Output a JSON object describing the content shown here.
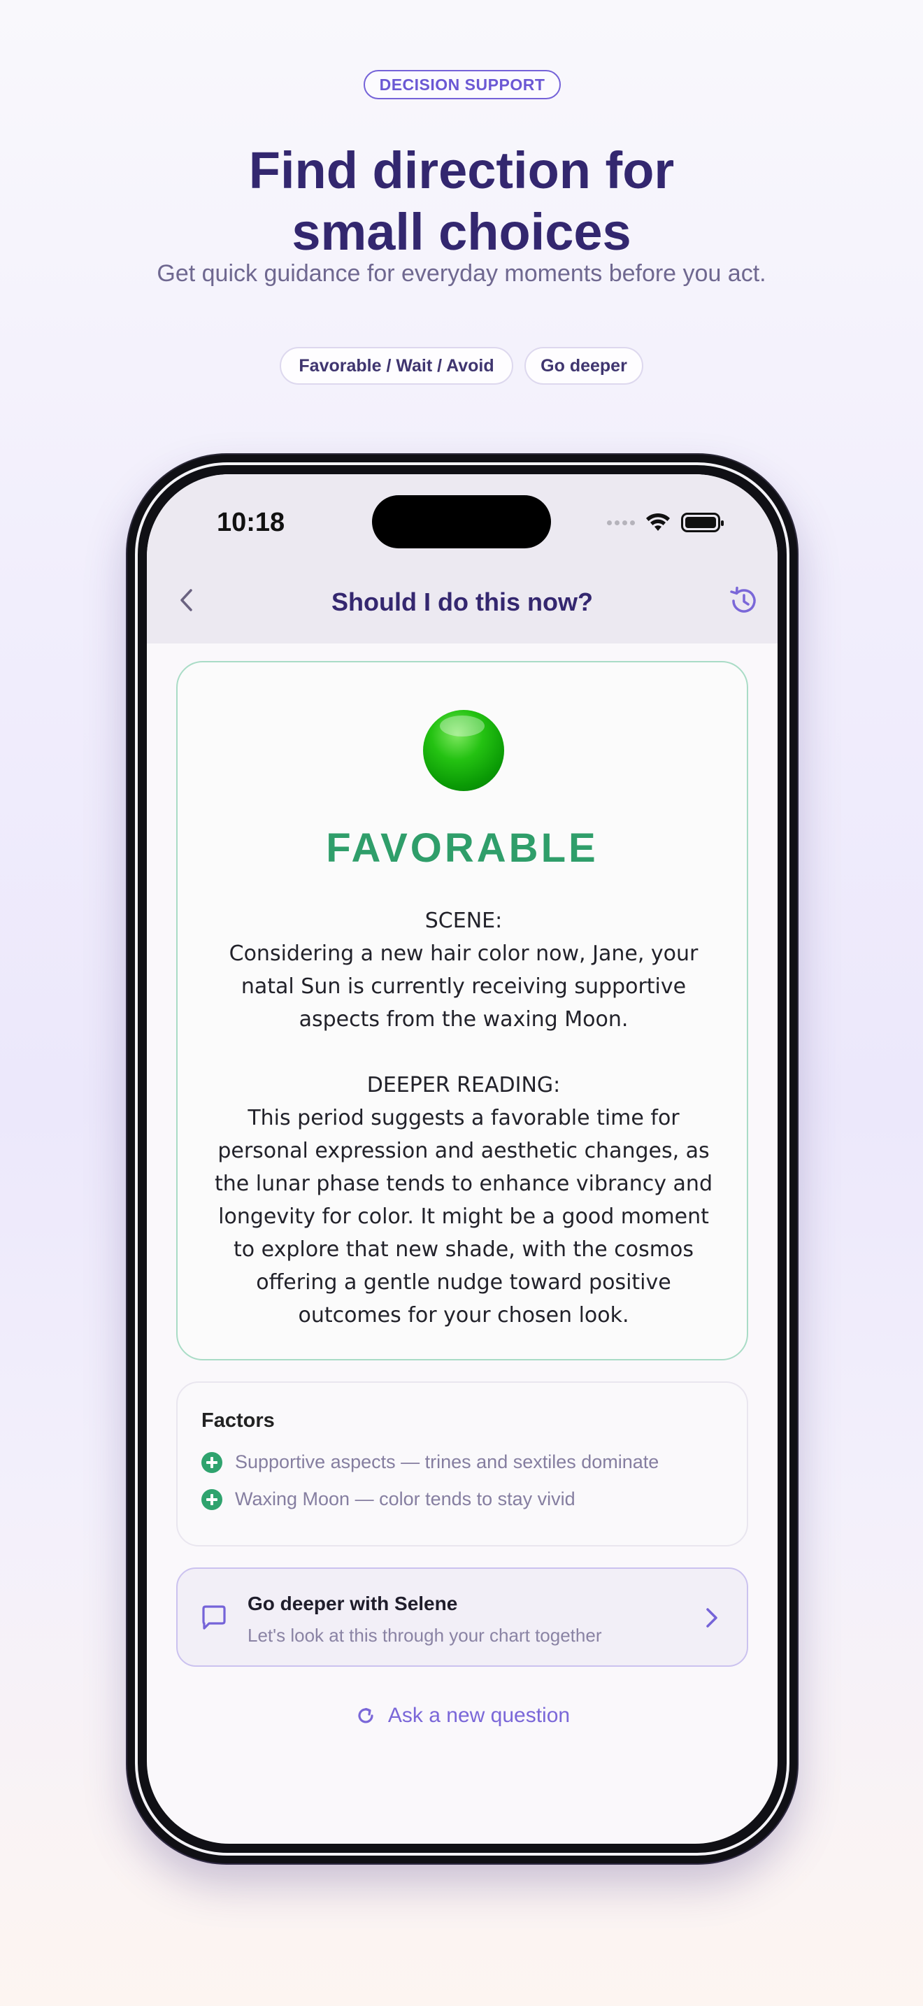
{
  "header": {
    "badge": "DECISION SUPPORT",
    "headline_line1": "Find direction for",
    "headline_line2": "small choices",
    "subheadline": "Get quick guidance for everyday moments before you act.",
    "pills": [
      "Favorable / Wait / Avoid",
      "Go deeper"
    ]
  },
  "status_bar": {
    "time": "10:18",
    "icons": [
      "signal-icon",
      "wifi-icon",
      "battery-icon"
    ]
  },
  "nav": {
    "title": "Should I do this now?",
    "back_icon": "chevron-left-icon",
    "history_icon": "history-icon"
  },
  "result": {
    "indicator_icon": "green-circle-icon",
    "verdict": "FAVORABLE",
    "scene_label": "SCENE:",
    "scene_text": "Considering a new hair color now, Jane, your natal Sun is currently receiving supportive aspects from the waxing Moon.",
    "deeper_label": "DEEPER READING:",
    "deeper_text": "This period suggests a favorable time for personal expression and aesthetic changes, as the lunar phase tends to enhance vibrancy and longevity for color. It might be a good moment to explore that new shade, with the cosmos offering a gentle nudge toward positive outcomes for your chosen look."
  },
  "factors": {
    "title": "Factors",
    "items": [
      "Supportive aspects — trines and sextiles dominate",
      "Waxing Moon — color tends to stay vivid"
    ]
  },
  "go_deeper": {
    "title": "Go deeper with Selene",
    "subtitle": "Let's look at this through your chart together"
  },
  "ask_new": {
    "label": "Ask a new question"
  },
  "colors": {
    "headline": "#33276f",
    "accent": "#7563d8",
    "favorable": "#2f9e6a"
  }
}
